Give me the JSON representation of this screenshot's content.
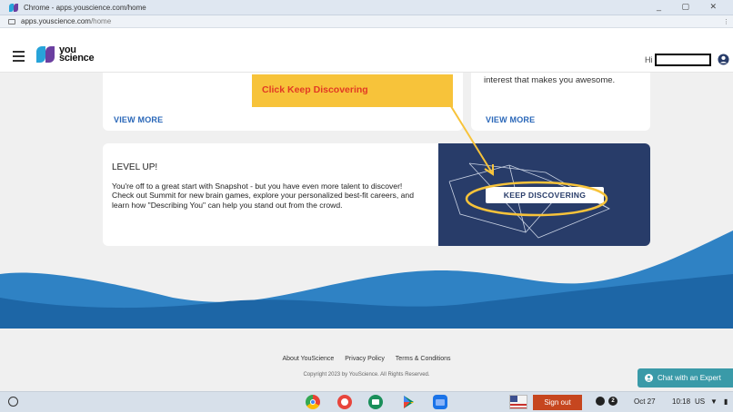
{
  "window": {
    "title": "Chrome - apps.youscience.com/home",
    "controls": "_ ▢ ✕"
  },
  "address_bar": {
    "host": "apps.youscience.com",
    "path": "/home"
  },
  "header": {
    "logo_line1": "you",
    "logo_line2": "science",
    "greeting": "Hi"
  },
  "cards": {
    "card1_link": "VIEW MORE",
    "card2_snippet": "interest that makes you awesome.",
    "card2_link": "VIEW MORE"
  },
  "level_up": {
    "title": "LEVEL UP!",
    "body": "You're off to a great start with Snapshot - but you have even more talent to discover! Check out Summit for new brain games, explore your personalized best-fit careers, and learn how \"Describing You\" can help you stand out from the crowd.",
    "button": "KEEP DISCOVERING"
  },
  "annotation": {
    "callout": "Click Keep Discovering"
  },
  "footer": {
    "links": [
      "About YouScience",
      "Privacy Policy",
      "Terms & Conditions"
    ],
    "copyright": "Copyright 2023 by YouScience. All Rights Reserved."
  },
  "chat": {
    "label": "Chat with an Expert"
  },
  "shelf": {
    "apps": [
      "chrome-icon",
      "paint-icon",
      "classroom-icon",
      "play-store-icon",
      "files-icon"
    ],
    "sign_out": "Sign out",
    "notification_count": "2",
    "date": "Oct 27",
    "time": "10:18",
    "locale": "US"
  },
  "colors": {
    "navy": "#283c69",
    "link_blue": "#2a67b8",
    "wave_blue": "#2f82c4",
    "callout_yellow": "#f7c33a",
    "callout_text": "#e23a24",
    "chat_teal": "#3a9aa8",
    "signout_red": "#c6461f"
  }
}
